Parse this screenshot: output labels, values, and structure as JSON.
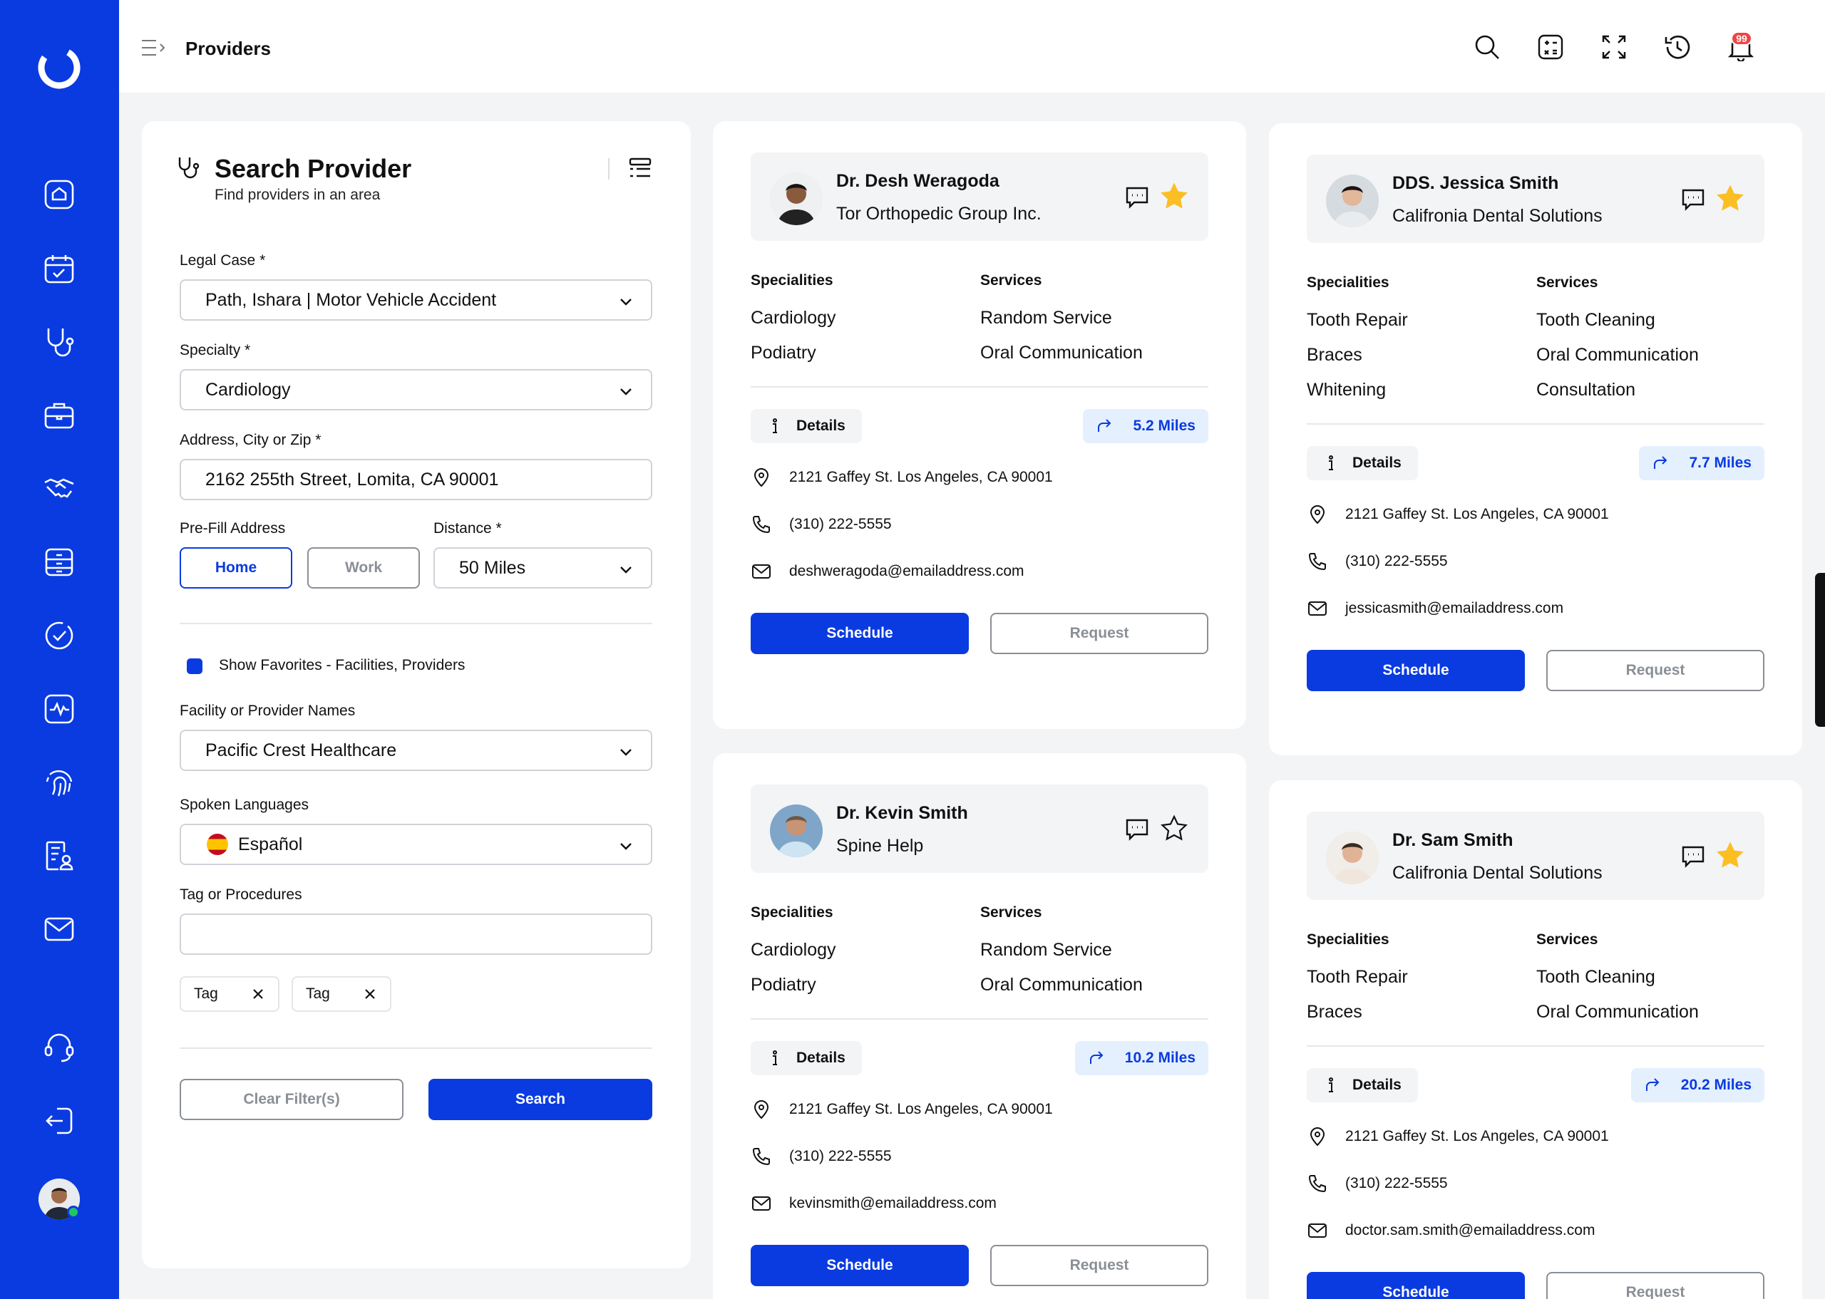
{
  "topbar": {
    "title": "Providers",
    "notification_count": "99"
  },
  "sidebar": {
    "items": [
      "home-icon",
      "calendar-check-icon",
      "stethoscope-icon",
      "briefcase-icon",
      "handshake-icon",
      "archive-icon",
      "check-circle-icon",
      "activity-icon",
      "fingerprint-icon",
      "document-user-icon",
      "mail-icon",
      "headset-icon",
      "logout-icon"
    ]
  },
  "search": {
    "title": "Search Provider",
    "subtitle": "Find providers in an area",
    "legal_case_label": "Legal Case *",
    "legal_case_value": "Path, Ishara | Motor Vehicle Accident",
    "specialty_label": "Specialty *",
    "specialty_value": "Cardiology",
    "address_label": "Address, City or Zip *",
    "address_value": "2162 255th Street, Lomita, CA 90001",
    "prefill_label": "Pre-Fill Address",
    "home_label": "Home",
    "work_label": "Work",
    "distance_label": "Distance *",
    "distance_value": "50 Miles",
    "favorites_label": "Show Favorites - Facilities, Providers",
    "facility_label": "Facility or Provider Names",
    "facility_value": "Pacific Crest Healthcare",
    "languages_label": "Spoken Languages",
    "language_value": "Español",
    "tags_label": "Tag or Procedures",
    "tags_value": "",
    "tags": [
      "Tag",
      "Tag"
    ],
    "clear_label": "Clear Filter(s)",
    "search_label": "Search"
  },
  "labels": {
    "specialities": "Specialities",
    "services": "Services",
    "details": "Details",
    "schedule": "Schedule",
    "request": "Request"
  },
  "providers": [
    {
      "name": "Dr. Desh Weragoda",
      "org": "Tor Orthopedic Group Inc.",
      "favorite": true,
      "specialities": [
        "Cardiology",
        "Podiatry"
      ],
      "services": [
        "Random Service",
        "Oral Communication"
      ],
      "miles": "5.2 Miles",
      "address": "2121 Gaffey St.  Los Angeles, CA 90001",
      "phone": "(310) 222-5555",
      "email": "deshweragoda@emailaddress.com"
    },
    {
      "name": "DDS. Jessica Smith",
      "org": "Califronia Dental Solutions",
      "favorite": true,
      "specialities": [
        "Tooth Repair",
        "Braces",
        "Whitening"
      ],
      "services": [
        "Tooth Cleaning",
        "Oral Communication",
        "Consultation"
      ],
      "miles": "7.7 Miles",
      "address": "2121 Gaffey St.  Los Angeles, CA 90001",
      "phone": "(310) 222-5555",
      "email": "jessicasmith@emailaddress.com"
    },
    {
      "name": "Dr. Kevin Smith",
      "org": "Spine Help",
      "favorite": false,
      "specialities": [
        "Cardiology",
        "Podiatry"
      ],
      "services": [
        "Random Service",
        "Oral Communication"
      ],
      "miles": "10.2 Miles",
      "address": "2121 Gaffey St.  Los Angeles, CA 90001",
      "phone": "(310) 222-5555",
      "email": "kevinsmith@emailaddress.com"
    },
    {
      "name": "Dr. Sam Smith",
      "org": "Califronia Dental Solutions",
      "favorite": true,
      "specialities": [
        "Tooth Repair",
        "Braces"
      ],
      "services": [
        "Tooth Cleaning",
        "Oral Communication"
      ],
      "miles": "20.2 Miles",
      "address": "2121 Gaffey St.  Los Angeles, CA 90001",
      "phone": "(310) 222-5555",
      "email": "doctor.sam.smith@emailaddress.com"
    }
  ],
  "colors": {
    "brand": "#0a3be0",
    "star": "#fbbf24",
    "miles_bg": "#e5f0ff"
  }
}
